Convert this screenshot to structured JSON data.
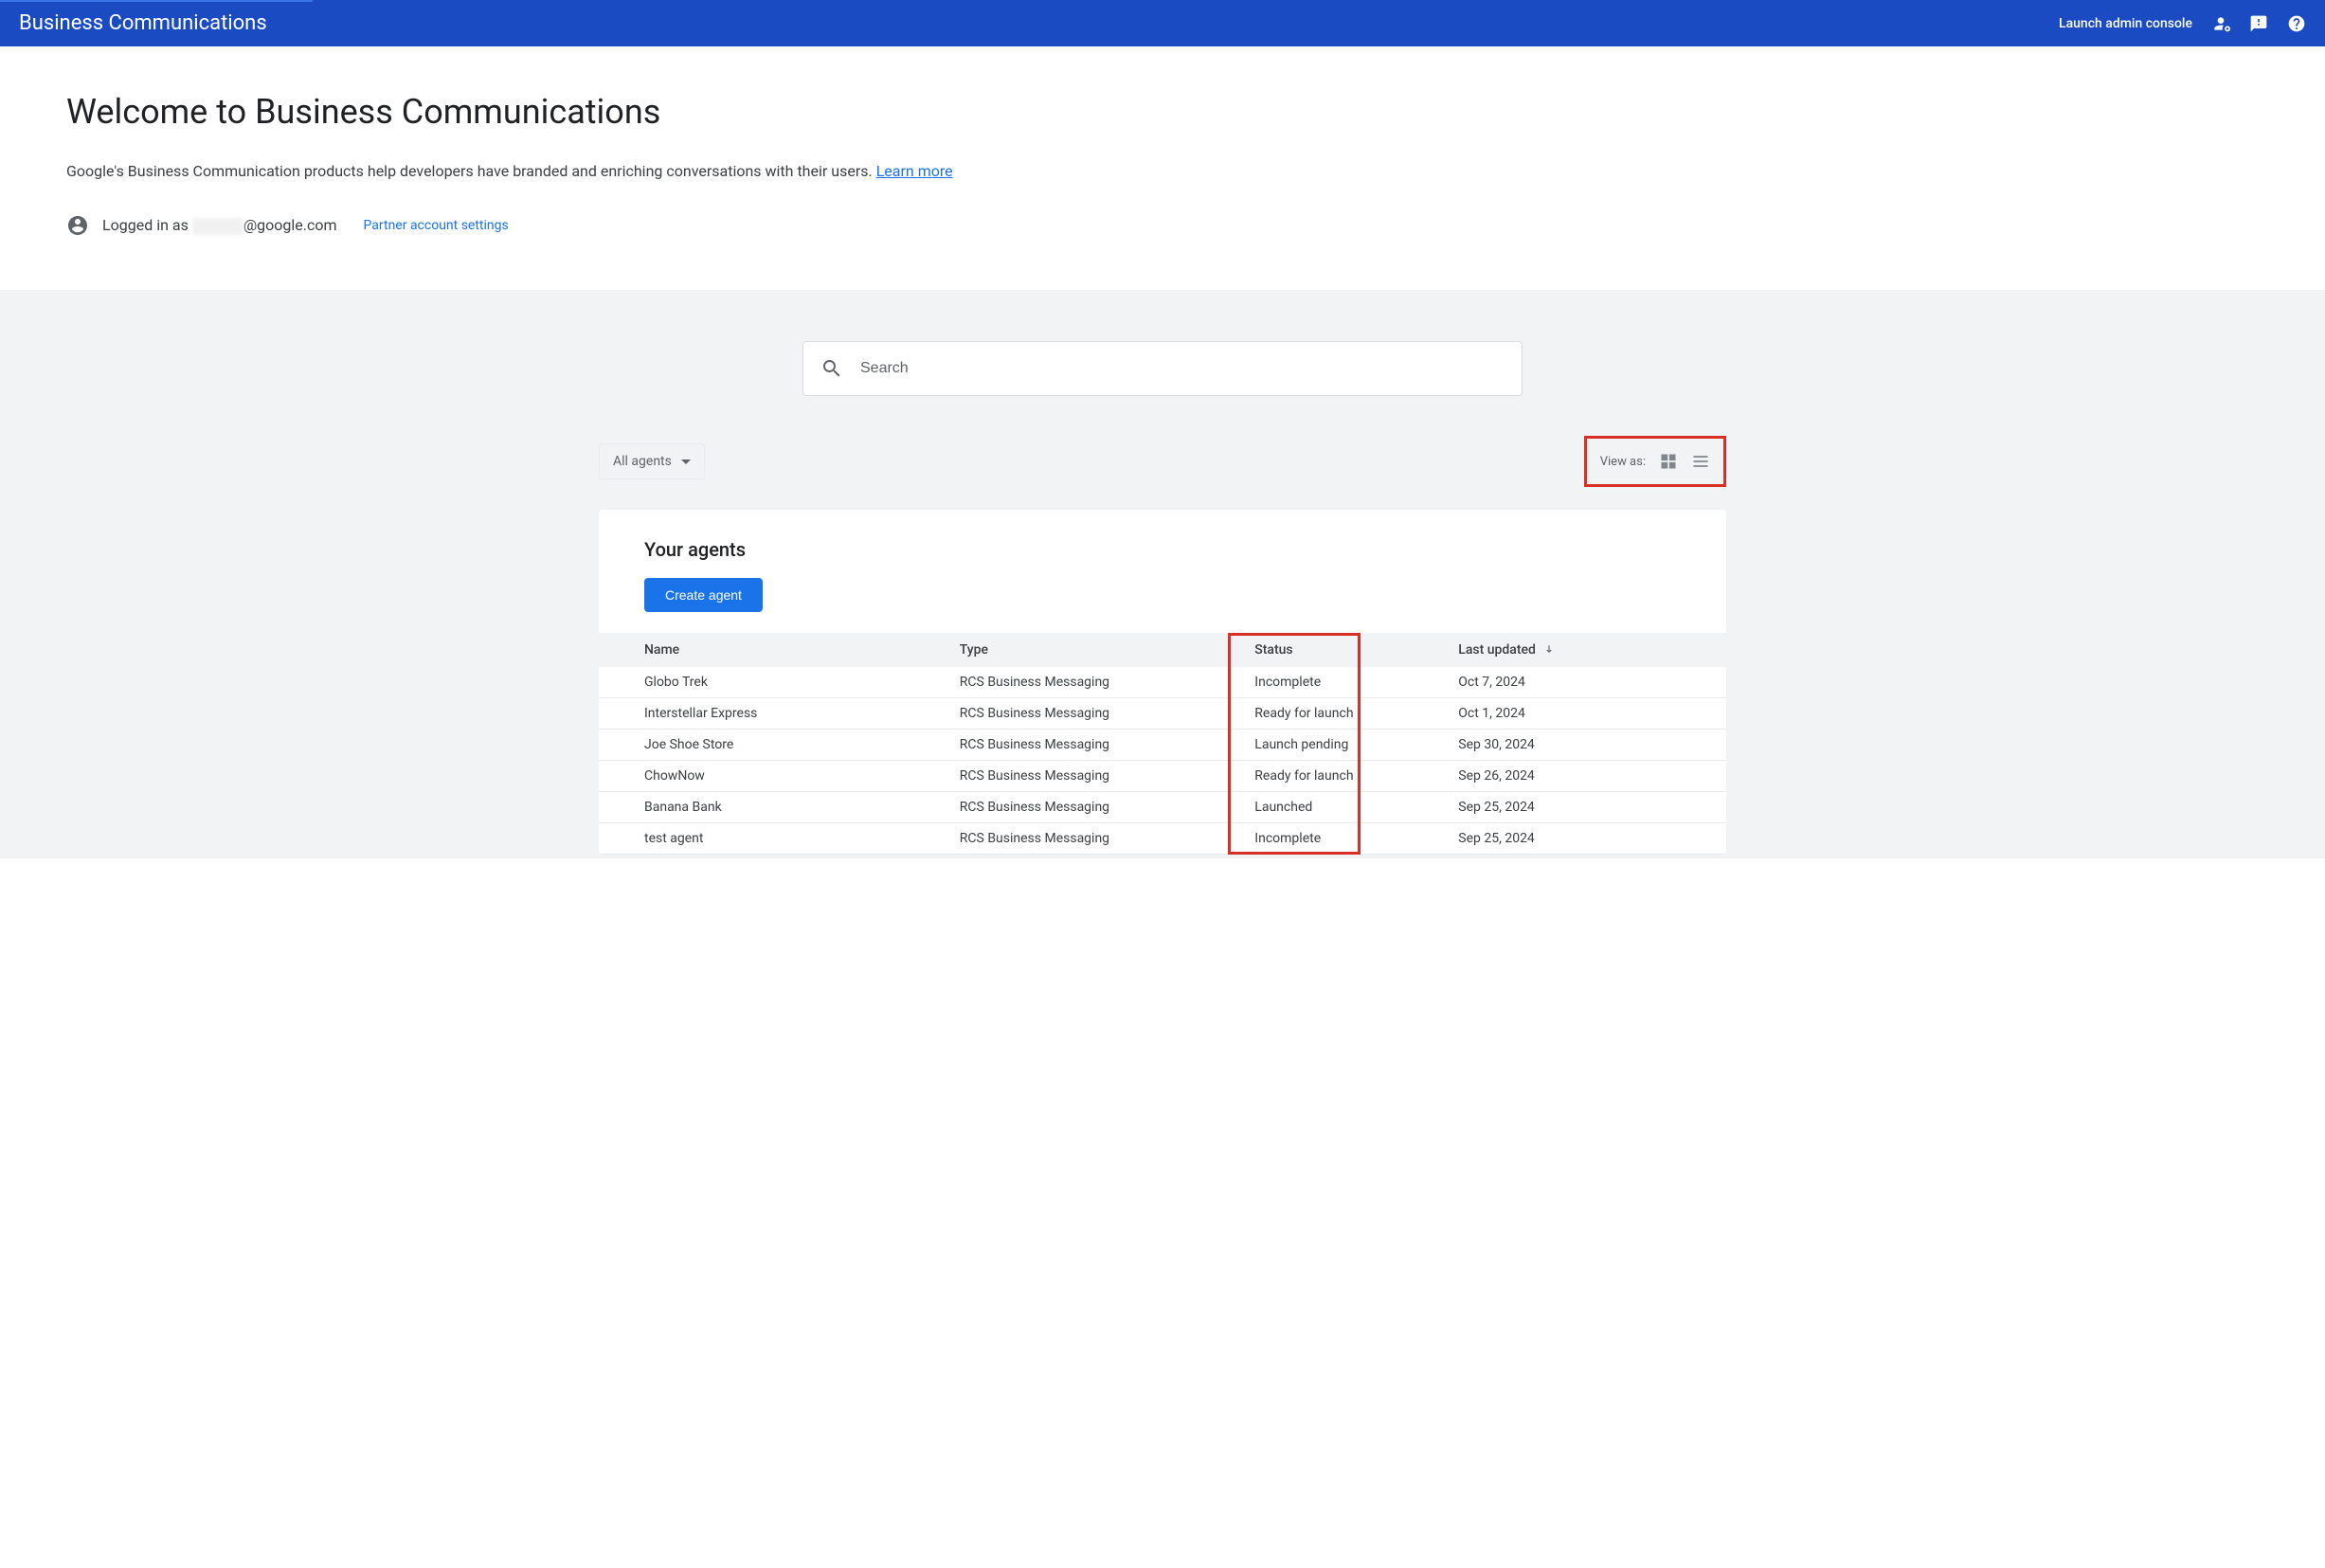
{
  "header": {
    "title": "Business Communications",
    "admin_link": "Launch admin console"
  },
  "welcome": {
    "title": "Welcome to Business Communications",
    "description": "Google's Business Communication products help developers have branded and enriching conversations with their users.",
    "learn_more": "Learn more",
    "logged_in_prefix": "Logged in as ",
    "email_suffix": "@google.com",
    "partner_settings": "Partner account settings"
  },
  "search": {
    "placeholder": "Search"
  },
  "controls": {
    "filter_label": "All agents",
    "view_label": "View as:"
  },
  "agents_card": {
    "title": "Your agents",
    "create_button": "Create agent"
  },
  "table": {
    "headers": {
      "name": "Name",
      "type": "Type",
      "status": "Status",
      "last_updated": "Last updated"
    },
    "rows": [
      {
        "name": "Globo Trek",
        "type": "RCS Business Messaging",
        "status": "Incomplete",
        "last_updated": "Oct 7, 2024"
      },
      {
        "name": "Interstellar Express",
        "type": "RCS Business Messaging",
        "status": "Ready for launch",
        "last_updated": "Oct 1, 2024"
      },
      {
        "name": "Joe Shoe Store",
        "type": "RCS Business Messaging",
        "status": "Launch pending",
        "last_updated": "Sep 30, 2024"
      },
      {
        "name": "ChowNow",
        "type": "RCS Business Messaging",
        "status": "Ready for launch",
        "last_updated": "Sep 26, 2024"
      },
      {
        "name": "Banana Bank",
        "type": "RCS Business Messaging",
        "status": "Launched",
        "last_updated": "Sep 25, 2024"
      },
      {
        "name": "test agent",
        "type": "RCS Business Messaging",
        "status": "Incomplete",
        "last_updated": "Sep 25, 2024"
      }
    ]
  }
}
